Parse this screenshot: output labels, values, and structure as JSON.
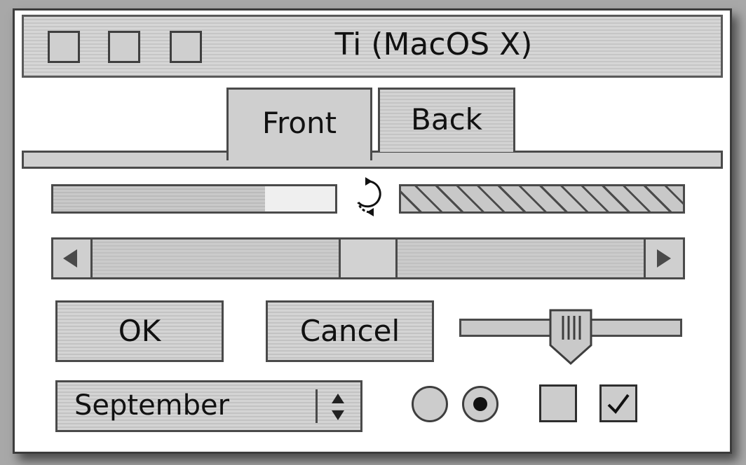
{
  "window": {
    "title": "Ti (MacOS X)"
  },
  "tabs": [
    {
      "label": "Front",
      "selected": true
    },
    {
      "label": "Back",
      "selected": false
    }
  ],
  "progress": {
    "value_fraction": 0.75
  },
  "scrollbar": {
    "position_fraction": 0.5
  },
  "buttons": {
    "ok_label": "OK",
    "cancel_label": "Cancel"
  },
  "slider": {
    "value_fraction": 0.5
  },
  "popup": {
    "selected_value": "September"
  },
  "radios": [
    {
      "checked": false
    },
    {
      "checked": true
    }
  ],
  "checkboxes": [
    {
      "checked": false
    },
    {
      "checked": true
    }
  ],
  "icons": {
    "spinner": "async-arrows-icon",
    "popup_arrows": "up-down-chevron-icon",
    "scroll_left": "triangle-left-icon",
    "scroll_right": "triangle-right-icon",
    "check": "checkmark-icon"
  },
  "colors": {
    "window_bg": "#ffffff",
    "chrome": "#cfcfcf",
    "border": "#4a4a4a",
    "desktop": "#a8a8a8"
  }
}
